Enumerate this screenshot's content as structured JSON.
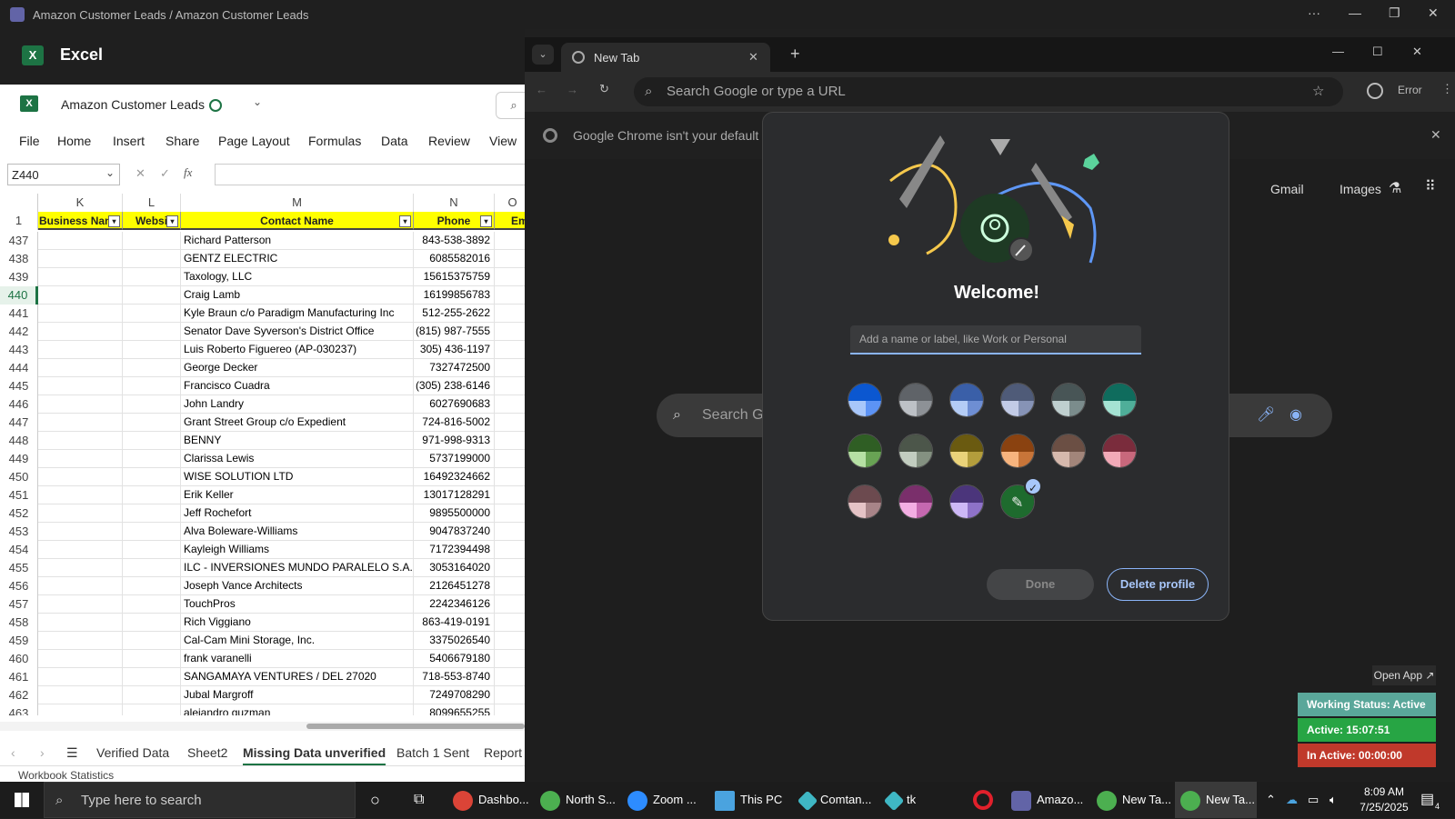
{
  "teams_titlebar": {
    "title": "Amazon Customer Leads / Amazon Customer Leads"
  },
  "excel": {
    "app_name": "Excel",
    "workbook_name": "Amazon Customer Leads",
    "menu": [
      "File",
      "Home",
      "Insert",
      "Share",
      "Page Layout",
      "Formulas",
      "Data",
      "Review",
      "View"
    ],
    "name_box": "Z440",
    "columns": [
      "K",
      "L",
      "M",
      "N",
      "O"
    ],
    "header_row_num": "1",
    "headers": [
      "Business Nan",
      "Websi",
      "Contact Name",
      "Phone",
      "Em"
    ],
    "rows": [
      {
        "num": "437",
        "name": "Richard Patterson",
        "phone": "843-538-3892"
      },
      {
        "num": "438",
        "name": "GENTZ ELECTRIC",
        "phone": "6085582016"
      },
      {
        "num": "439",
        "name": "Taxology, LLC",
        "phone": "15615375759"
      },
      {
        "num": "440",
        "name": "Craig Lamb",
        "phone": "16199856783"
      },
      {
        "num": "441",
        "name": "Kyle Braun c/o Paradigm Manufacturing Inc",
        "phone": "512-255-2622"
      },
      {
        "num": "442",
        "name": "Senator Dave Syverson's District Office",
        "phone": "(815) 987-7555"
      },
      {
        "num": "443",
        "name": "Luis Roberto Figuereo    (AP-030237)",
        "phone": "305) 436-1197"
      },
      {
        "num": "444",
        "name": "George Decker",
        "phone": "7327472500"
      },
      {
        "num": "445",
        "name": "Francisco Cuadra",
        "phone": "(305) 238-6146"
      },
      {
        "num": "446",
        "name": "John Landry",
        "phone": "6027690683"
      },
      {
        "num": "447",
        "name": "Grant Street Group c/o Expedient",
        "phone": "724-816-5002"
      },
      {
        "num": "448",
        "name": "BENNY",
        "phone": "971-998-9313"
      },
      {
        "num": "449",
        "name": "Clarissa Lewis",
        "phone": "5737199000"
      },
      {
        "num": "450",
        "name": "WISE SOLUTION LTD",
        "phone": "16492324662"
      },
      {
        "num": "451",
        "name": "Erik Keller",
        "phone": "13017128291"
      },
      {
        "num": "452",
        "name": "Jeff Rochefort",
        "phone": "9895500000"
      },
      {
        "num": "453",
        "name": "Alva Boleware-Williams",
        "phone": "9047837240"
      },
      {
        "num": "454",
        "name": "Kayleigh Williams",
        "phone": "7172394498"
      },
      {
        "num": "455",
        "name": "ILC - INVERSIONES MUNDO PARALELO S.A.",
        "phone": "3053164020"
      },
      {
        "num": "456",
        "name": "Joseph Vance Architects",
        "phone": "2126451278"
      },
      {
        "num": "457",
        "name": "TouchPros",
        "phone": "2242346126"
      },
      {
        "num": "458",
        "name": "Rich Viggiano",
        "phone": "863-419-0191"
      },
      {
        "num": "459",
        "name": "Cal-Cam Mini Storage, Inc.",
        "phone": "3375026540"
      },
      {
        "num": "460",
        "name": "frank varanelli",
        "phone": "5406679180"
      },
      {
        "num": "461",
        "name": "SANGAMAYA VENTURES / DEL 27020",
        "phone": "718-553-8740"
      },
      {
        "num": "462",
        "name": "Jubal Margroff",
        "phone": "7249708290"
      },
      {
        "num": "463",
        "name": "alejandro guzman",
        "phone": "8099655255"
      }
    ],
    "sheet_tabs": [
      "Verified Data",
      "Sheet2",
      "Missing Data unverified",
      "Batch 1 Sent",
      "Report"
    ],
    "active_tab": "Missing Data unverified",
    "status": "Workbook Statistics"
  },
  "chrome": {
    "tab_title": "New Tab",
    "omnibox_placeholder": "Search Google or type a URL",
    "error_label": "Error",
    "banner": "Google Chrome isn't your default br",
    "links": [
      "Gmail",
      "Images"
    ],
    "search_placeholder": "Search G"
  },
  "dialog": {
    "title": "Welcome!",
    "input_placeholder": "Add a name or label, like Work or Personal",
    "done_label": "Done",
    "delete_label": "Delete profile",
    "swatches": [
      [
        "#0b57d0",
        "#a8c7fa",
        "#5c93f5"
      ],
      [
        "#5f6368",
        "#bdc1c6",
        "#8d9196"
      ],
      [
        "#3a5fa8",
        "#b4ccf5",
        "#6e8ed3"
      ],
      [
        "#4f5b78",
        "#c2cbe6",
        "#8693b6"
      ],
      [
        "#485556",
        "#bfcfcf",
        "#7b8c8c"
      ],
      [
        "#0f6c5d",
        "#a5e3d3",
        "#4fae99"
      ],
      [
        "#2f5e24",
        "#b6e0a4",
        "#68a354"
      ],
      [
        "#4c564a",
        "#c2cdc0",
        "#849181"
      ],
      [
        "#6a5a10",
        "#ead37a",
        "#b39d3c"
      ],
      [
        "#8a4210",
        "#f7b47e",
        "#c87539"
      ],
      [
        "#6b4f44",
        "#d6b9ad",
        "#a2857a"
      ],
      [
        "#7a2c3c",
        "#f2aab8",
        "#c8687c"
      ],
      [
        "#6c4a4f",
        "#e5c3c6",
        "#a88488"
      ],
      [
        "#7a2f6b",
        "#f3aee3",
        "#c568b0"
      ],
      [
        "#4b357b",
        "#cdb8f6",
        "#8e72c8"
      ],
      [
        "#1e6b2e",
        "#2e8b3f",
        "#2e8b3f"
      ]
    ]
  },
  "widget": {
    "open_app": "Open App ↗",
    "status": "Working Status: Active",
    "active": "Active: 15:07:51",
    "inactive": "In Active: 00:00:00"
  },
  "taskbar": {
    "search_placeholder": "Type here to search",
    "apps": [
      "Dashbo...",
      "North S...",
      "Zoom ...",
      "This PC",
      "Comtan...",
      "tk",
      "Amazo...",
      "New Ta...",
      "New Ta..."
    ],
    "time": "8:09 AM",
    "date": "7/25/2025",
    "notif_count": "4"
  }
}
